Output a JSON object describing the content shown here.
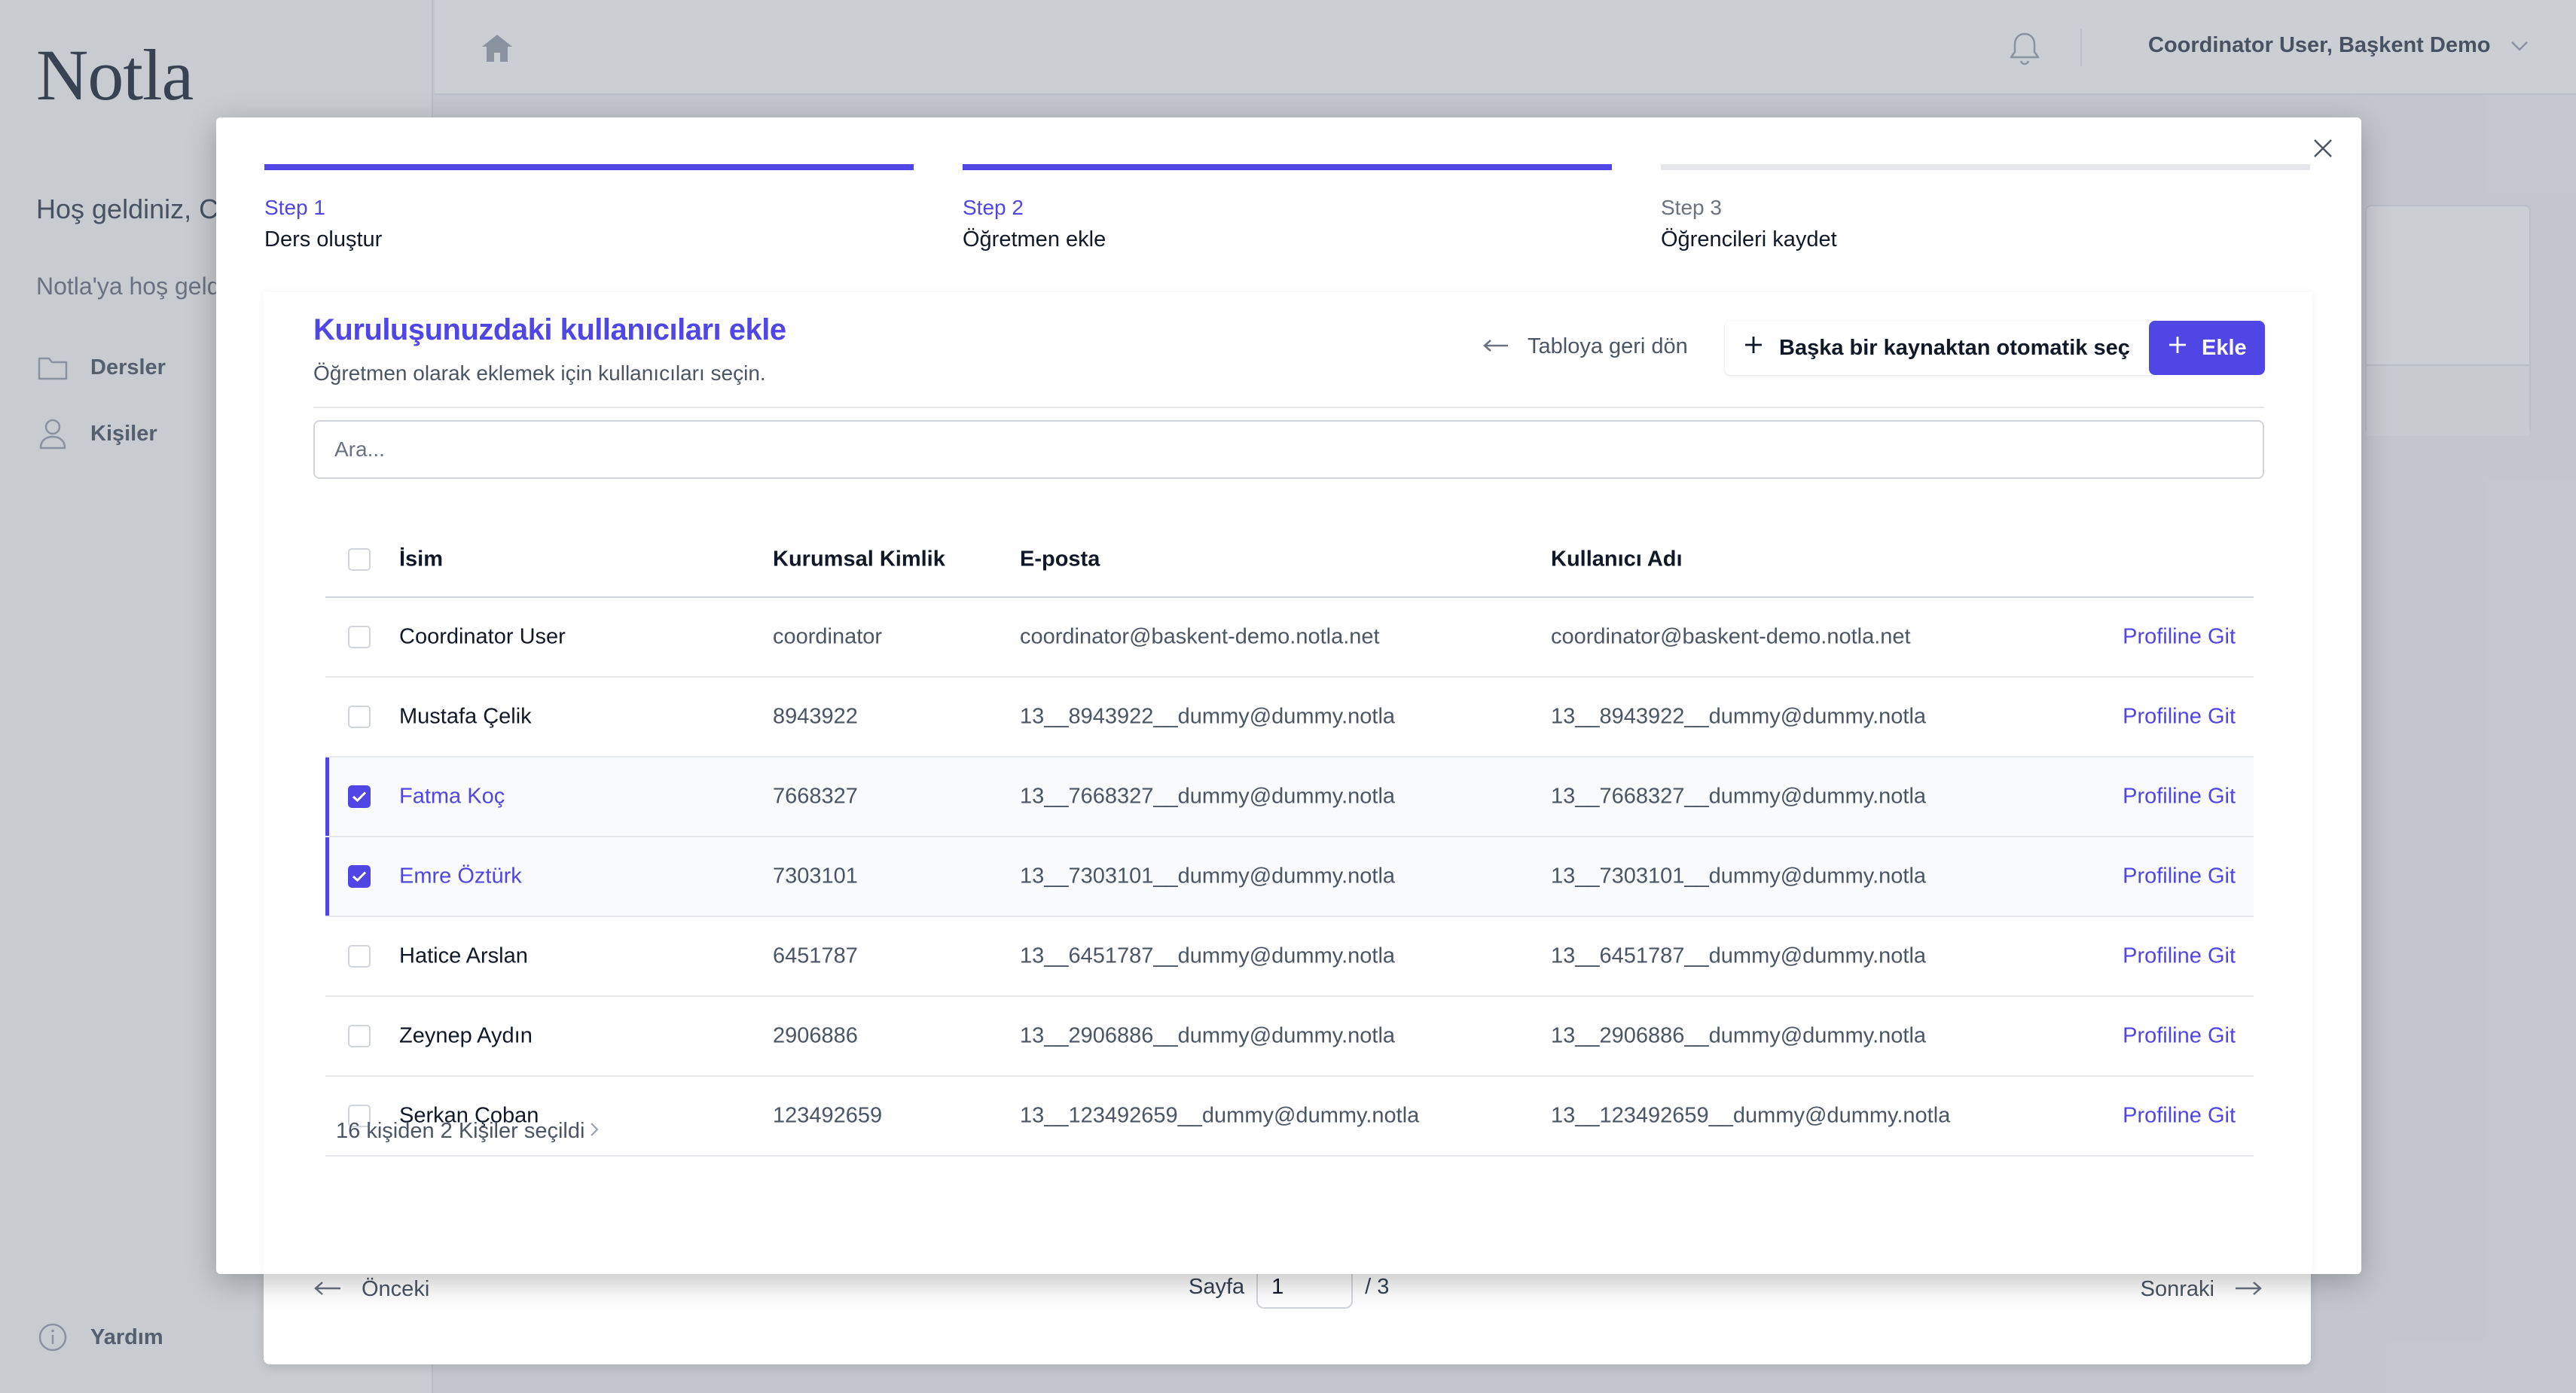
{
  "app": {
    "logo": "Notla",
    "welcome_title": "Hoş geldiniz, Coordinator User!",
    "welcome_sub": "Notla'ya hoş geldiniz",
    "nav": [
      {
        "label": "Dersler",
        "icon": "folder-icon"
      },
      {
        "label": "Kişiler",
        "icon": "user-icon"
      }
    ],
    "help": "Yardım",
    "user_menu": "Coordinator User, Başkent Demo"
  },
  "steps": [
    {
      "label": "Step 1",
      "name": "Ders oluştur",
      "state": "complete"
    },
    {
      "label": "Step 2",
      "name": "Öğretmen ekle",
      "state": "current"
    },
    {
      "label": "Step 3",
      "name": "Öğrencileri kaydet",
      "state": "upcoming"
    }
  ],
  "panel": {
    "title": "Kuruluşunuzdaki kullanıcıları ekle",
    "subtitle": "Öğretmen olarak eklemek için kullanıcıları seçin.",
    "back_link": "Tabloya geri dön",
    "auto_select": "Başka bir kaynaktan otomatik seç",
    "add": "Ekle",
    "search_placeholder": "Ara...",
    "columns": {
      "name": "İsim",
      "corp_id": "Kurumsal Kimlik",
      "email": "E-posta",
      "username": "Kullanıcı Adı"
    },
    "rows": [
      {
        "name": "Coordinator User",
        "corp_id": "coordinator",
        "email": "coordinator@baskent-demo.notla.net",
        "username": "coordinator@baskent-demo.notla.net",
        "link": "Profiline Git",
        "selected": false
      },
      {
        "name": "Mustafa Çelik",
        "corp_id": "8943922",
        "email": "13__8943922__dummy@dummy.notla",
        "username": "13__8943922__dummy@dummy.notla",
        "link": "Profiline Git",
        "selected": false
      },
      {
        "name": "Fatma Koç",
        "corp_id": "7668327",
        "email": "13__7668327__dummy@dummy.notla",
        "username": "13__7668327__dummy@dummy.notla",
        "link": "Profiline Git",
        "selected": true
      },
      {
        "name": "Emre Öztürk",
        "corp_id": "7303101",
        "email": "13__7303101__dummy@dummy.notla",
        "username": "13__7303101__dummy@dummy.notla",
        "link": "Profiline Git",
        "selected": true
      },
      {
        "name": "Hatice Arslan",
        "corp_id": "6451787",
        "email": "13__6451787__dummy@dummy.notla",
        "username": "13__6451787__dummy@dummy.notla",
        "link": "Profiline Git",
        "selected": false
      },
      {
        "name": "Zeynep Aydın",
        "corp_id": "2906886",
        "email": "13__2906886__dummy@dummy.notla",
        "username": "13__2906886__dummy@dummy.notla",
        "link": "Profiline Git",
        "selected": false
      },
      {
        "name": "Serkan Çoban",
        "corp_id": "123492659",
        "email": "13__123492659__dummy@dummy.notla",
        "username": "13__123492659__dummy@dummy.notla",
        "link": "Profiline Git",
        "selected": false
      }
    ],
    "selection_summary": "16 kişiden 2 Kişiler seçildi"
  },
  "pagination": {
    "prev": "Önceki",
    "page_label": "Sayfa",
    "page_value": "1",
    "total": "/ 3",
    "next": "Sonraki"
  },
  "colors": {
    "accent": "#4f46e5",
    "text": "#111827",
    "muted": "#4b5563",
    "border": "#e5e7eb"
  }
}
